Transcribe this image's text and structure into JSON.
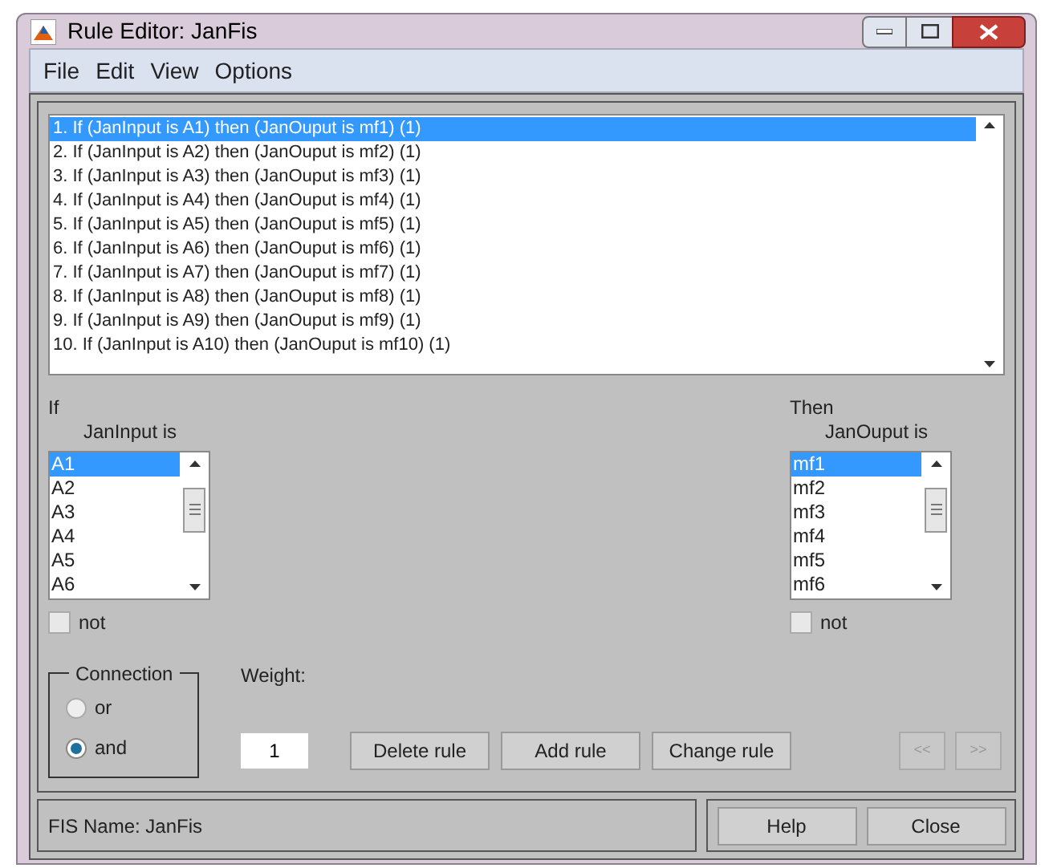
{
  "window": {
    "title": "Rule Editor: JanFis"
  },
  "menu": [
    "File",
    "Edit",
    "View",
    "Options"
  ],
  "rules": [
    {
      "text": "1. If (JanInput is A1) then (JanOuput is mf1) (1)",
      "selected": true
    },
    {
      "text": "2. If (JanInput is A2) then (JanOuput is mf2) (1)",
      "selected": false
    },
    {
      "text": "3. If (JanInput is A3) then (JanOuput is mf3) (1)",
      "selected": false
    },
    {
      "text": "4. If (JanInput is A4) then (JanOuput is mf4) (1)",
      "selected": false
    },
    {
      "text": "5. If (JanInput is A5) then (JanOuput is mf5) (1)",
      "selected": false
    },
    {
      "text": "6. If (JanInput is A6) then (JanOuput is mf6) (1)",
      "selected": false
    },
    {
      "text": "7. If (JanInput is A7) then (JanOuput is mf7) (1)",
      "selected": false
    },
    {
      "text": "8. If (JanInput is A8) then (JanOuput is mf8) (1)",
      "selected": false
    },
    {
      "text": "9. If (JanInput is A9) then (JanOuput is mf9) (1)",
      "selected": false
    },
    {
      "text": "10. If (JanInput is A10) then (JanOuput is mf10) (1)",
      "selected": false
    }
  ],
  "antecedent": {
    "label": "If",
    "variable": "JanInput is",
    "items": [
      {
        "label": "A1",
        "selected": true
      },
      {
        "label": "A2",
        "selected": false
      },
      {
        "label": "A3",
        "selected": false
      },
      {
        "label": "A4",
        "selected": false
      },
      {
        "label": "A5",
        "selected": false
      },
      {
        "label": "A6",
        "selected": false
      }
    ],
    "not": {
      "label": "not",
      "checked": false
    }
  },
  "consequent": {
    "label": "Then",
    "variable": "JanOuput is",
    "items": [
      {
        "label": "mf1",
        "selected": true
      },
      {
        "label": "mf2",
        "selected": false
      },
      {
        "label": "mf3",
        "selected": false
      },
      {
        "label": "mf4",
        "selected": false
      },
      {
        "label": "mf5",
        "selected": false
      },
      {
        "label": "mf6",
        "selected": false
      }
    ],
    "not": {
      "label": "not",
      "checked": false
    }
  },
  "connection": {
    "title": "Connection",
    "options": [
      {
        "label": "or",
        "selected": false
      },
      {
        "label": "and",
        "selected": true
      }
    ]
  },
  "weight": {
    "label": "Weight:",
    "value": "1"
  },
  "buttons": [
    "Delete rule",
    "Add rule",
    "Change rule"
  ],
  "nav_buttons": [
    {
      "label": "<<",
      "disabled": true
    },
    {
      "label": ">>",
      "disabled": true
    }
  ],
  "status": "FIS Name: JanFis",
  "footer_buttons": [
    "Help",
    "Close"
  ]
}
